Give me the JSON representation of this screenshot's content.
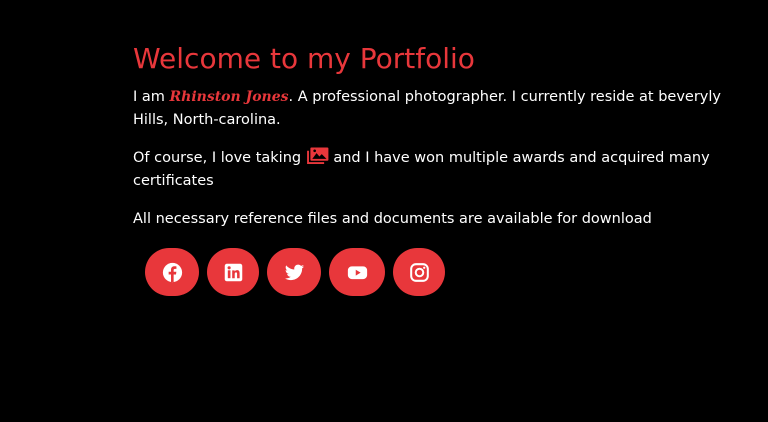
{
  "hero": {
    "title": "Welcome to my Portfolio",
    "intro_prefix": "I am ",
    "name": "Rhinston Jones",
    "intro_suffix": ". A professional photographer. I currently reside at beveryly Hills, North-carolina.",
    "love_prefix": "Of course, I love taking ",
    "love_suffix": " and I have won multiple awards and acquired many certificates",
    "downloads_text": "All necessary reference files and documents are available for download"
  },
  "inline_icon": "images-icon",
  "socials": [
    {
      "icon": "facebook-icon"
    },
    {
      "icon": "linkedin-icon"
    },
    {
      "icon": "twitter-icon"
    },
    {
      "icon": "youtube-icon"
    },
    {
      "icon": "instagram-icon"
    }
  ],
  "colors": {
    "accent": "#e8373b",
    "background": "#000000",
    "text": "#ffffff"
  }
}
